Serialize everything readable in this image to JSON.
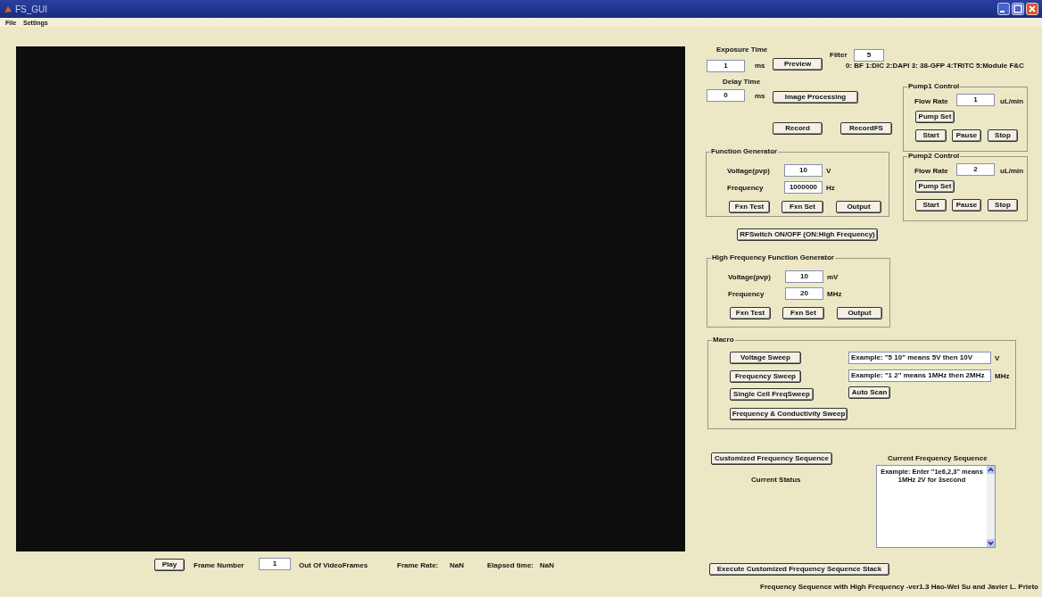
{
  "window": {
    "title": "FS_GUI"
  },
  "menu": [
    "File",
    "Settings"
  ],
  "camera": {
    "exposure_label": "Exposure Time",
    "exposure": "1",
    "exposure_unit": "ms",
    "delay_label": "Delay Time",
    "delay": "0",
    "delay_unit": "ms",
    "filter_label": "Filter",
    "filter": "5",
    "filter_legend": "0: BF 1:DIC 2:DAPI 3: 38-GFP 4:TRITC 5:Module F&C",
    "buttons": [
      "Preview",
      "Image Processing",
      "Record",
      "RecordFS"
    ]
  },
  "pumps": [
    {
      "title": "Pump1 Control",
      "flow_label": "Flow Rate",
      "flow": "1",
      "unit": "uL/min",
      "set": "Pump Set",
      "buttons": [
        "Start",
        "Pause",
        "Stop"
      ]
    },
    {
      "title": "Pump2 Control",
      "flow_label": "Flow Rate",
      "flow": "2",
      "unit": "uL/min",
      "set": "Pump Set",
      "buttons": [
        "Start",
        "Pause",
        "Stop"
      ]
    }
  ],
  "generators": [
    {
      "title": "Function Generator",
      "rows": [
        {
          "label": "Voltage(pvp)",
          "value": "10",
          "unit": "V"
        },
        {
          "label": "Frequency",
          "value": "1000000",
          "unit": "Hz"
        }
      ],
      "buttons": [
        "Fxn Test",
        "Fxn Set",
        "Output"
      ]
    },
    {
      "title": "High Frequency Function Generator",
      "rows": [
        {
          "label": "Voltage(pvp)",
          "value": "10",
          "unit": "mV"
        },
        {
          "label": "Frequency",
          "value": "20",
          "unit": "MHz"
        }
      ],
      "buttons": [
        "Fxn Test",
        "Fxn Set",
        "Output"
      ]
    }
  ],
  "rf_switch": "RFSwitch ON/OFF (ON:High Frequency)",
  "macro": {
    "title": "Macro",
    "buttons": [
      "Voltage Sweep",
      "Frequency Sweep",
      "Single Cell FreqSweep",
      "Frequency & Conductivity Sweep"
    ],
    "fields": [
      {
        "value": "Example:  \"5 10\" means 5V then 10V",
        "unit": "V"
      },
      {
        "value": "Example:  \"1 2\" means 1MHz then 2MHz",
        "unit": "MHz"
      }
    ],
    "auto_scan": "Auto Scan"
  },
  "sequence": {
    "button": "Customized Frequency Sequence",
    "status_label": "Current Status",
    "list_title": "Current Frequency Sequence",
    "list_text": "Example: Enter \"1e6,2,3\" means 1MHz 2V for 3second",
    "execute": "Execute Customized Frequency Sequence Stack"
  },
  "playback": {
    "play": "Play",
    "frame_label": "Frame Number",
    "frame": "1",
    "out_of": "Out Of",
    "video_frames": "VideoFrames",
    "rate_label": "Frame Rate:",
    "rate": "NaN",
    "elapsed_label": "Elapsed time:",
    "elapsed": "NaN"
  },
  "footer": "Frequency Sequence with High Frequency -ver1.3 Hao-Wei Su and Javier L. Prieto"
}
